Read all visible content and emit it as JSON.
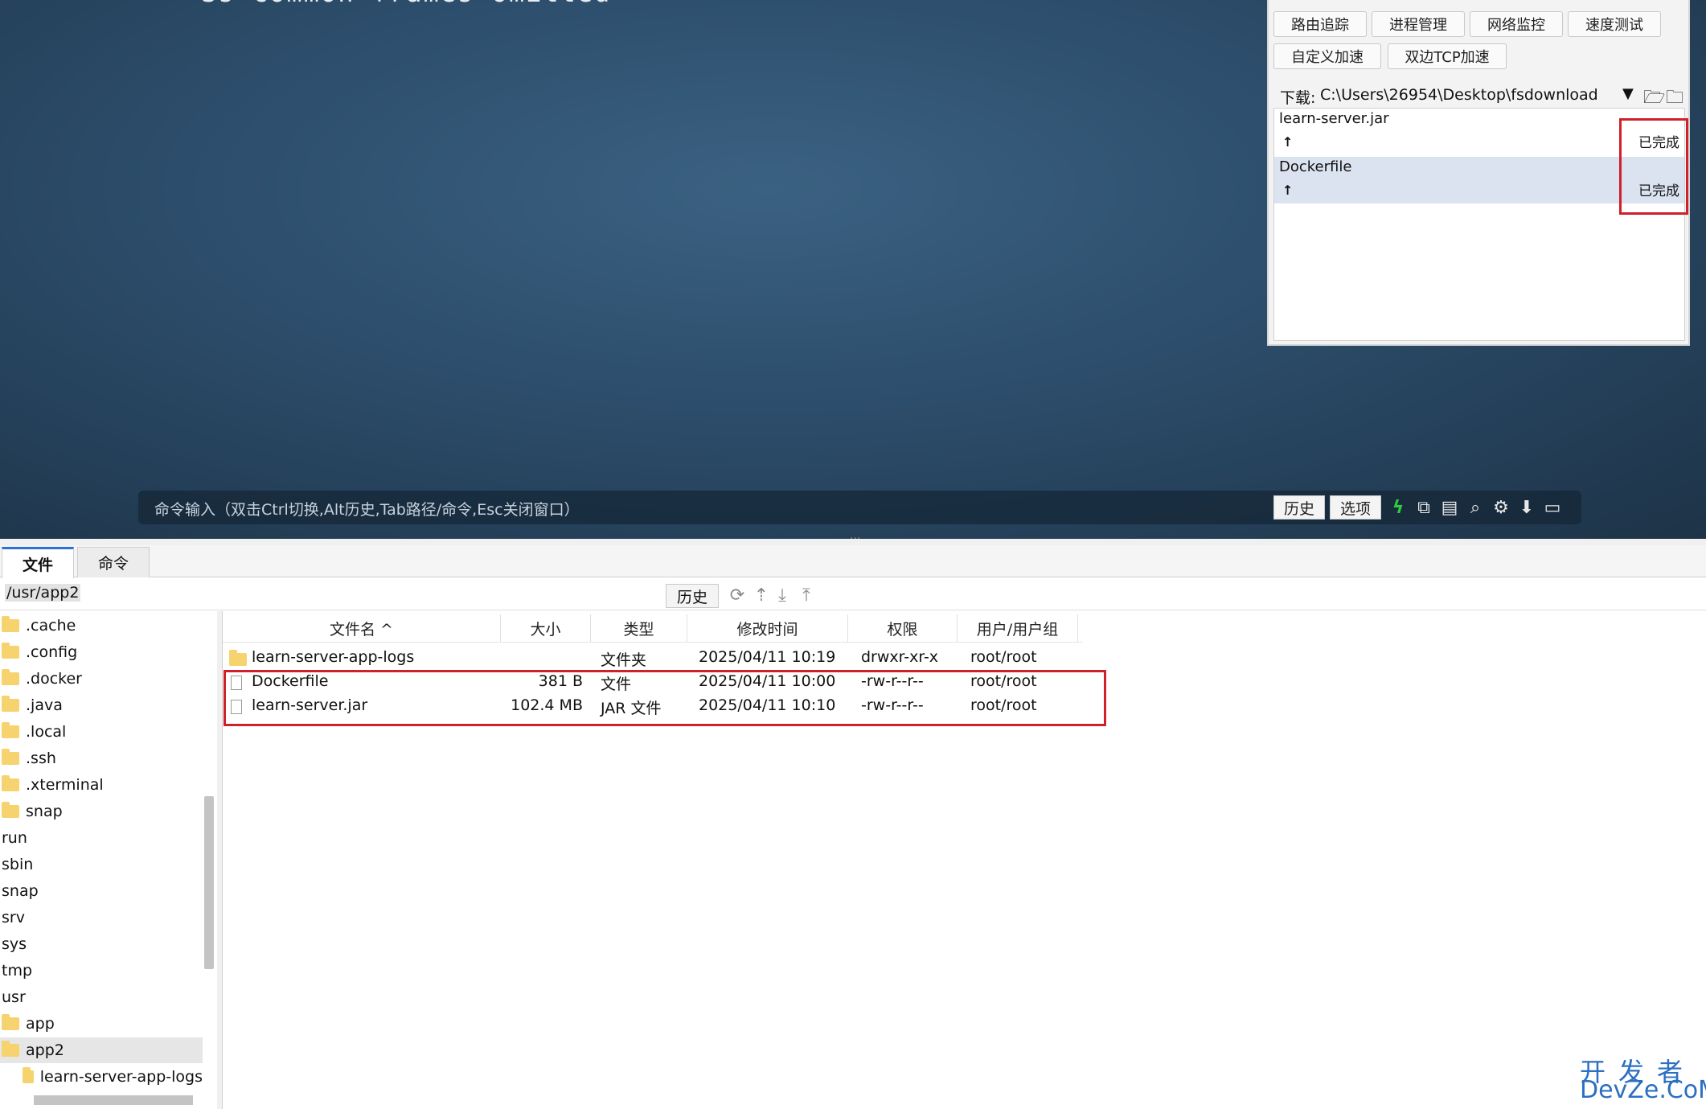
{
  "terminal": {
    "top_line": "*** Ss common frames omitted",
    "command_placeholder": "命令输入（双击Ctrl切换,Alt历史,Tab路径/命令,Esc关闭窗口）",
    "history_label": "历史",
    "options_label": "选项",
    "icons": [
      "bolt-icon",
      "copy-icon",
      "paste-icon",
      "search-icon",
      "gear-icon",
      "download-icon",
      "maximize-icon"
    ]
  },
  "tools": {
    "buttons_row1": [
      "路由追踪",
      "进程管理",
      "网络监控",
      "速度测试"
    ],
    "buttons_row2": [
      "自定义加速",
      "双边TCP加速"
    ],
    "download_label": "下载:",
    "download_path": "C:\\Users\\26954\\Desktop\\fsdownload",
    "transfers": [
      {
        "name": "learn-server.jar",
        "direction": "↑",
        "status": "已完成"
      },
      {
        "name": "Dockerfile",
        "direction": "↑",
        "status": "已完成"
      }
    ]
  },
  "tabs": [
    "文件",
    "命令"
  ],
  "path_bar": {
    "path": "/usr/app2",
    "history_label": "历史",
    "icons": [
      "refresh-icon",
      "up-dir-icon",
      "download-icon",
      "upload-icon"
    ]
  },
  "tree": [
    {
      "label": ".cache",
      "folder": true
    },
    {
      "label": ".config",
      "folder": true
    },
    {
      "label": ".docker",
      "folder": true
    },
    {
      "label": ".java",
      "folder": true
    },
    {
      "label": ".local",
      "folder": true
    },
    {
      "label": ".ssh",
      "folder": true
    },
    {
      "label": ".xterminal",
      "folder": true
    },
    {
      "label": "snap",
      "folder": true
    },
    {
      "label": "run",
      "folder": false
    },
    {
      "label": "sbin",
      "folder": false
    },
    {
      "label": "snap",
      "folder": false
    },
    {
      "label": "srv",
      "folder": false
    },
    {
      "label": "sys",
      "folder": false
    },
    {
      "label": "tmp",
      "folder": false
    },
    {
      "label": "usr",
      "folder": false
    },
    {
      "label": "app",
      "folder": true
    },
    {
      "label": "app2",
      "folder": true
    },
    {
      "label": "learn-server-app-logs",
      "folder": true
    }
  ],
  "file_table": {
    "columns": [
      "文件名 ^",
      "大小",
      "类型",
      "修改时间",
      "权限",
      "用户/用户组"
    ],
    "rows": [
      {
        "name": "learn-server-app-logs",
        "size": "",
        "type": "文件夹",
        "modified": "2025/04/11 10:19",
        "perms": "drwxr-xr-x",
        "owner": "root/root",
        "folder": true
      },
      {
        "name": "Dockerfile",
        "size": "381 B",
        "type": "文件",
        "modified": "2025/04/11 10:00",
        "perms": "-rw-r--r--",
        "owner": "root/root",
        "folder": false
      },
      {
        "name": "learn-server.jar",
        "size": "102.4 MB",
        "type": "JAR 文件",
        "modified": "2025/04/11 10:10",
        "perms": "-rw-r--r--",
        "owner": "root/root",
        "folder": false
      }
    ]
  },
  "watermark": {
    "top": "开发者",
    "bottom": "DevZe.CoM"
  },
  "colors": {
    "terminal_bg": "#2c4d6b",
    "highlight_box": "#d0202a",
    "tab_accent": "#2a72d8",
    "folder": "#f6d36e",
    "watermark": "#2b6fc2"
  }
}
